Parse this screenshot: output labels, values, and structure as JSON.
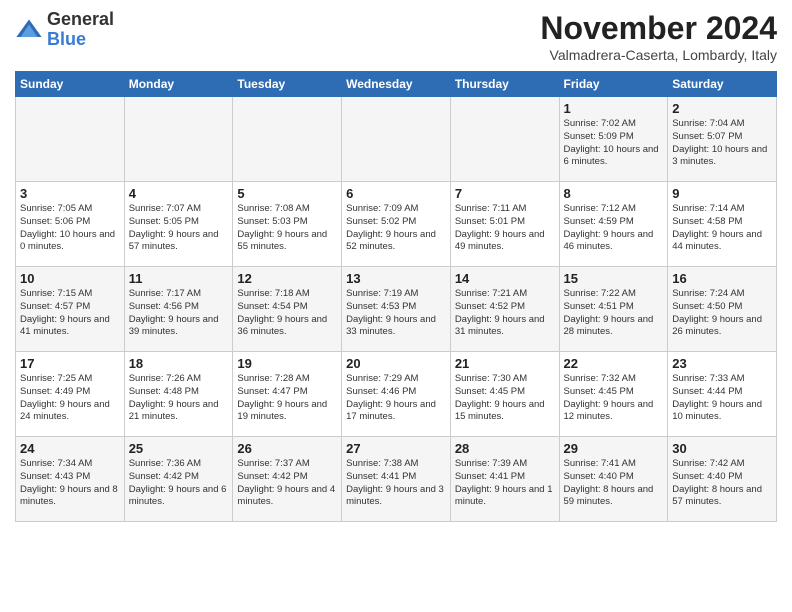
{
  "logo": {
    "general": "General",
    "blue": "Blue"
  },
  "header": {
    "title": "November 2024",
    "subtitle": "Valmadrera-Caserta, Lombardy, Italy"
  },
  "weekdays": [
    "Sunday",
    "Monday",
    "Tuesday",
    "Wednesday",
    "Thursday",
    "Friday",
    "Saturday"
  ],
  "weeks": [
    [
      {
        "day": "",
        "info": ""
      },
      {
        "day": "",
        "info": ""
      },
      {
        "day": "",
        "info": ""
      },
      {
        "day": "",
        "info": ""
      },
      {
        "day": "",
        "info": ""
      },
      {
        "day": "1",
        "info": "Sunrise: 7:02 AM\nSunset: 5:09 PM\nDaylight: 10 hours and 6 minutes."
      },
      {
        "day": "2",
        "info": "Sunrise: 7:04 AM\nSunset: 5:07 PM\nDaylight: 10 hours and 3 minutes."
      }
    ],
    [
      {
        "day": "3",
        "info": "Sunrise: 7:05 AM\nSunset: 5:06 PM\nDaylight: 10 hours and 0 minutes."
      },
      {
        "day": "4",
        "info": "Sunrise: 7:07 AM\nSunset: 5:05 PM\nDaylight: 9 hours and 57 minutes."
      },
      {
        "day": "5",
        "info": "Sunrise: 7:08 AM\nSunset: 5:03 PM\nDaylight: 9 hours and 55 minutes."
      },
      {
        "day": "6",
        "info": "Sunrise: 7:09 AM\nSunset: 5:02 PM\nDaylight: 9 hours and 52 minutes."
      },
      {
        "day": "7",
        "info": "Sunrise: 7:11 AM\nSunset: 5:01 PM\nDaylight: 9 hours and 49 minutes."
      },
      {
        "day": "8",
        "info": "Sunrise: 7:12 AM\nSunset: 4:59 PM\nDaylight: 9 hours and 46 minutes."
      },
      {
        "day": "9",
        "info": "Sunrise: 7:14 AM\nSunset: 4:58 PM\nDaylight: 9 hours and 44 minutes."
      }
    ],
    [
      {
        "day": "10",
        "info": "Sunrise: 7:15 AM\nSunset: 4:57 PM\nDaylight: 9 hours and 41 minutes."
      },
      {
        "day": "11",
        "info": "Sunrise: 7:17 AM\nSunset: 4:56 PM\nDaylight: 9 hours and 39 minutes."
      },
      {
        "day": "12",
        "info": "Sunrise: 7:18 AM\nSunset: 4:54 PM\nDaylight: 9 hours and 36 minutes."
      },
      {
        "day": "13",
        "info": "Sunrise: 7:19 AM\nSunset: 4:53 PM\nDaylight: 9 hours and 33 minutes."
      },
      {
        "day": "14",
        "info": "Sunrise: 7:21 AM\nSunset: 4:52 PM\nDaylight: 9 hours and 31 minutes."
      },
      {
        "day": "15",
        "info": "Sunrise: 7:22 AM\nSunset: 4:51 PM\nDaylight: 9 hours and 28 minutes."
      },
      {
        "day": "16",
        "info": "Sunrise: 7:24 AM\nSunset: 4:50 PM\nDaylight: 9 hours and 26 minutes."
      }
    ],
    [
      {
        "day": "17",
        "info": "Sunrise: 7:25 AM\nSunset: 4:49 PM\nDaylight: 9 hours and 24 minutes."
      },
      {
        "day": "18",
        "info": "Sunrise: 7:26 AM\nSunset: 4:48 PM\nDaylight: 9 hours and 21 minutes."
      },
      {
        "day": "19",
        "info": "Sunrise: 7:28 AM\nSunset: 4:47 PM\nDaylight: 9 hours and 19 minutes."
      },
      {
        "day": "20",
        "info": "Sunrise: 7:29 AM\nSunset: 4:46 PM\nDaylight: 9 hours and 17 minutes."
      },
      {
        "day": "21",
        "info": "Sunrise: 7:30 AM\nSunset: 4:45 PM\nDaylight: 9 hours and 15 minutes."
      },
      {
        "day": "22",
        "info": "Sunrise: 7:32 AM\nSunset: 4:45 PM\nDaylight: 9 hours and 12 minutes."
      },
      {
        "day": "23",
        "info": "Sunrise: 7:33 AM\nSunset: 4:44 PM\nDaylight: 9 hours and 10 minutes."
      }
    ],
    [
      {
        "day": "24",
        "info": "Sunrise: 7:34 AM\nSunset: 4:43 PM\nDaylight: 9 hours and 8 minutes."
      },
      {
        "day": "25",
        "info": "Sunrise: 7:36 AM\nSunset: 4:42 PM\nDaylight: 9 hours and 6 minutes."
      },
      {
        "day": "26",
        "info": "Sunrise: 7:37 AM\nSunset: 4:42 PM\nDaylight: 9 hours and 4 minutes."
      },
      {
        "day": "27",
        "info": "Sunrise: 7:38 AM\nSunset: 4:41 PM\nDaylight: 9 hours and 3 minutes."
      },
      {
        "day": "28",
        "info": "Sunrise: 7:39 AM\nSunset: 4:41 PM\nDaylight: 9 hours and 1 minute."
      },
      {
        "day": "29",
        "info": "Sunrise: 7:41 AM\nSunset: 4:40 PM\nDaylight: 8 hours and 59 minutes."
      },
      {
        "day": "30",
        "info": "Sunrise: 7:42 AM\nSunset: 4:40 PM\nDaylight: 8 hours and 57 minutes."
      }
    ]
  ]
}
